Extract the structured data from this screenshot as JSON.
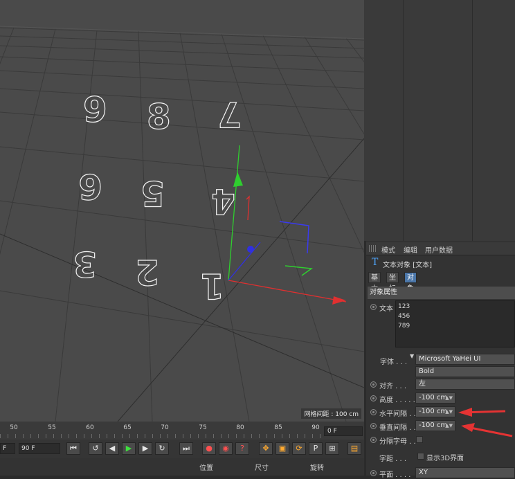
{
  "viewport": {
    "grid_readout": "网格间距 : 100 cm",
    "digits": [
      "1",
      "2",
      "3",
      "4",
      "5",
      "6",
      "7",
      "8",
      "9"
    ]
  },
  "attr": {
    "menu": {
      "mode": "模式",
      "edit": "编辑",
      "userdata": "用户数据"
    },
    "object_title": "文本对象 [文本]",
    "tabs": {
      "basic": "基本",
      "coord": "坐标",
      "object": "对象"
    },
    "section": "对象属性",
    "text_label": "文本",
    "text_lines": [
      "123",
      "456",
      "789"
    ],
    "font_label": "字体 . . .",
    "font_name": "Microsoft YaHei UI",
    "font_style": "Bold",
    "align_label": "对齐 . . .",
    "align_value": "左",
    "height_label": "高度 . . . . .",
    "height_value": "-100 cm",
    "hspace_label": "水平间隔 . .",
    "hspace_value": "-100 cm",
    "vspace_label": "垂直间隔 . .",
    "vspace_value": "-100 cm",
    "split_label": "分隔字母 . .",
    "kerning_label": "字距 . . .",
    "show3d_label": "显示3D界面",
    "plane_label": "平面 . . . .",
    "plane_value": "XY"
  },
  "timeline": {
    "ticks": [
      "50",
      "55",
      "60",
      "65",
      "70",
      "75",
      "80",
      "85",
      "90"
    ],
    "current_frame": "0 F"
  },
  "transport": {
    "frame_left": "F",
    "end_frame": "90 F"
  },
  "coords": {
    "position": "位置",
    "size": "尺寸",
    "rotation": "旋转"
  },
  "colors": {
    "accent": "#4b76a8",
    "annotation_arrow": "#e53333",
    "axis_x": "#e03030",
    "axis_y": "#2fcf2f",
    "axis_z": "#3030e0"
  }
}
